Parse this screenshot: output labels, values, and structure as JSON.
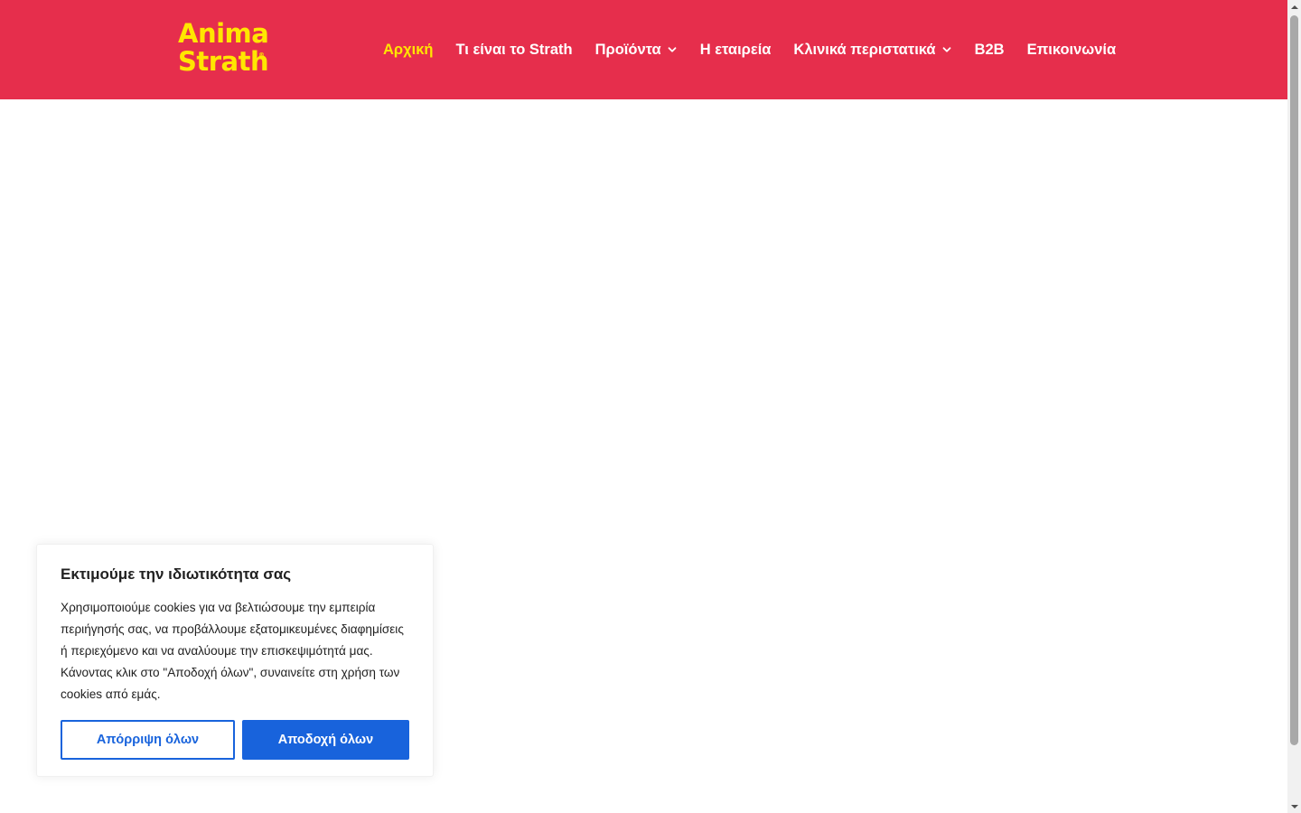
{
  "brand": {
    "logo_line1": "Anima",
    "logo_line2": "Strath",
    "logo_mark": "®"
  },
  "nav": {
    "items": [
      {
        "label": "Αρχική",
        "active": true,
        "has_dropdown": false
      },
      {
        "label": "Τι είναι το Strath",
        "active": false,
        "has_dropdown": false
      },
      {
        "label": "Προϊόντα",
        "active": false,
        "has_dropdown": true
      },
      {
        "label": "Η εταιρεία",
        "active": false,
        "has_dropdown": false
      },
      {
        "label": "Κλινικά περιστατικά",
        "active": false,
        "has_dropdown": true
      },
      {
        "label": "B2B",
        "active": false,
        "has_dropdown": false
      },
      {
        "label": "Επικοινωνία",
        "active": false,
        "has_dropdown": false
      }
    ]
  },
  "cookie_banner": {
    "title": "Εκτιμούμε την ιδιωτικότητα σας",
    "text": "Χρησιμοποιούμε cookies για να βελτιώσουμε την εμπειρία περιήγησής σας, να προβάλλουμε εξατομικευμένες διαφημίσεις ή περιεχόμενο και να αναλύουμε την επισκεψιμότητά μας. Κάνοντας κλικ στο \"Αποδοχή όλων\", συναινείτε στη χρήση των cookies από εμάς.",
    "reject_label": "Απόρριψη όλων",
    "accept_label": "Αποδοχή όλων"
  },
  "colors": {
    "header_bg": "#e62e4c",
    "logo": "#ffe600",
    "nav_active": "#ffe600",
    "nav_text": "#ffffff",
    "primary_button": "#1863dc"
  },
  "icons": {
    "dropdown": "chevron-down-icon",
    "scroll_up": "scroll-up-arrow-icon",
    "scroll_down": "scroll-down-arrow-icon"
  }
}
